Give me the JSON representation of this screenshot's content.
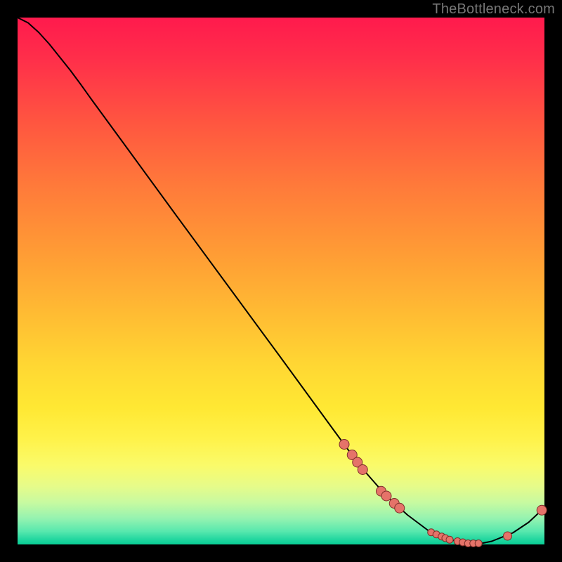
{
  "watermark": "TheBottleneck.com",
  "chart_data": {
    "type": "line",
    "title": "",
    "xlabel": "",
    "ylabel": "",
    "xlim": [
      0,
      100
    ],
    "ylim": [
      0,
      100
    ],
    "grid": false,
    "legend": false,
    "series": [
      {
        "name": "curve",
        "x": [
          0,
          2,
          4,
          6,
          8,
          10,
          12,
          14,
          20,
          30,
          40,
          50,
          60,
          65,
          70,
          74,
          78,
          82,
          86,
          88,
          90,
          94,
          97,
          100
        ],
        "y": [
          100,
          99,
          97.2,
          95,
          92.5,
          90,
          87.3,
          84.5,
          76.3,
          62.6,
          49,
          35.4,
          21.7,
          14.9,
          9.2,
          5.6,
          2.6,
          0.9,
          0.2,
          0.2,
          0.6,
          2.2,
          4.2,
          7
        ]
      }
    ],
    "markers": [
      {
        "x": 62.0,
        "y": 19.0,
        "r": 7
      },
      {
        "x": 63.5,
        "y": 17.0,
        "r": 7
      },
      {
        "x": 64.5,
        "y": 15.6,
        "r": 7
      },
      {
        "x": 65.5,
        "y": 14.2,
        "r": 7
      },
      {
        "x": 69.0,
        "y": 10.1,
        "r": 7
      },
      {
        "x": 70.0,
        "y": 9.2,
        "r": 7
      },
      {
        "x": 71.5,
        "y": 7.8,
        "r": 7
      },
      {
        "x": 72.5,
        "y": 6.9,
        "r": 7
      },
      {
        "x": 78.5,
        "y": 2.3,
        "r": 5
      },
      {
        "x": 79.5,
        "y": 1.9,
        "r": 5
      },
      {
        "x": 80.5,
        "y": 1.5,
        "r": 5
      },
      {
        "x": 81.2,
        "y": 1.2,
        "r": 5
      },
      {
        "x": 82.0,
        "y": 0.9,
        "r": 5
      },
      {
        "x": 83.5,
        "y": 0.6,
        "r": 5
      },
      {
        "x": 84.5,
        "y": 0.4,
        "r": 5
      },
      {
        "x": 85.5,
        "y": 0.2,
        "r": 5
      },
      {
        "x": 86.5,
        "y": 0.2,
        "r": 5
      },
      {
        "x": 87.5,
        "y": 0.2,
        "r": 5
      },
      {
        "x": 93.0,
        "y": 1.6,
        "r": 6
      },
      {
        "x": 99.5,
        "y": 6.5,
        "r": 7
      }
    ],
    "line_color": "#000000",
    "marker_fill": "#e57369",
    "marker_stroke": "#7e2f2a"
  }
}
